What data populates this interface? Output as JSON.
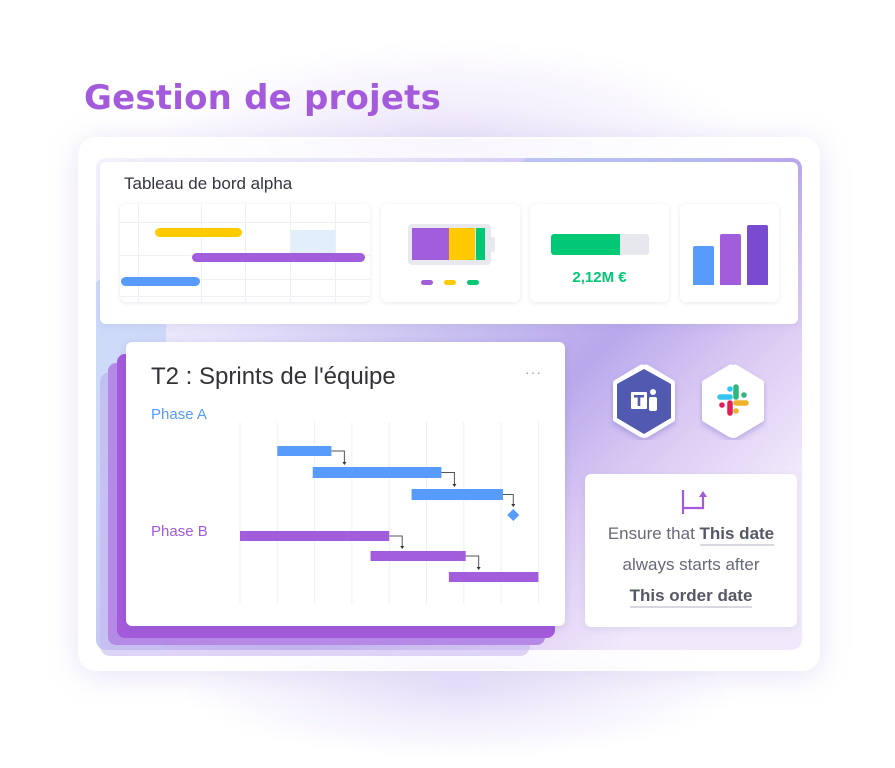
{
  "header": {
    "title": "Gestion de projets"
  },
  "dashboard": {
    "title": "Tableau de bord alpha",
    "mini_gantt": {
      "bars": [
        {
          "name": "task-yellow",
          "color": "#ffcb00",
          "start": 0.14,
          "end": 0.49,
          "row": 1
        },
        {
          "name": "task-purple",
          "color": "#a25ddc",
          "start": 0.29,
          "end": 0.99,
          "row": 2
        },
        {
          "name": "task-blue",
          "color": "#579bfc",
          "start": 0.0,
          "end": 0.32,
          "row": 3
        }
      ]
    },
    "battery": {
      "segments": [
        {
          "label": "purple",
          "color": "#a25ddc",
          "value": 0.51
        },
        {
          "label": "yellow",
          "color": "#ffcb00",
          "value": 0.36
        },
        {
          "label": "green",
          "color": "#00c875",
          "value": 0.13
        }
      ],
      "legend_colors": [
        "#a25ddc",
        "#ffcb00",
        "#00c875"
      ]
    },
    "budget": {
      "progress": 0.7,
      "value_label": "2,12M €",
      "color": "#00c875"
    },
    "bar_chart": {
      "values": [
        0.65,
        0.85,
        1.0
      ],
      "colors": [
        "#579bfc",
        "#a25ddc",
        "#784bd1"
      ]
    }
  },
  "sprint_card": {
    "title": "T2 : Sprints de l'équipe",
    "more_label": "···",
    "phases": [
      {
        "label": "Phase A",
        "color": "#579bfc",
        "tasks": [
          {
            "start": 1.0,
            "end": 2.45
          },
          {
            "start": 1.95,
            "end": 5.4
          },
          {
            "start": 4.6,
            "end": 7.05
          }
        ],
        "milestone": 7.3
      },
      {
        "label": "Phase B",
        "color": "#a25ddc",
        "tasks": [
          {
            "start": 0.0,
            "end": 4.0
          },
          {
            "start": 3.5,
            "end": 6.05
          },
          {
            "start": 5.6,
            "end": 8.0
          }
        ]
      }
    ],
    "columns": 8
  },
  "integrations": [
    {
      "name": "Microsoft Teams",
      "icon": "teams-icon"
    },
    {
      "name": "Slack",
      "icon": "slack-icon"
    }
  ],
  "automation": {
    "icon": "dependency-arrow-icon",
    "line1_prefix": "Ensure that ",
    "line1_field": "This date",
    "line2": "always starts after",
    "line3_field": "This order date"
  }
}
